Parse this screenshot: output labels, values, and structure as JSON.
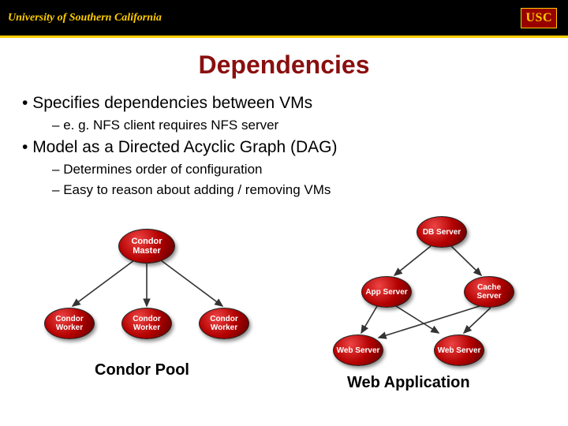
{
  "header": {
    "university": "University of Southern California",
    "logo_text": "USC"
  },
  "slide": {
    "title": "Dependencies",
    "bullets": [
      {
        "level": 1,
        "text": "Specifies dependencies between VMs"
      },
      {
        "level": 2,
        "text": "e. g. NFS client requires NFS server"
      },
      {
        "level": 1,
        "text": "Model as a Directed Acyclic Graph (DAG)"
      },
      {
        "level": 2,
        "text": "Determines order of configuration"
      },
      {
        "level": 2,
        "text": "Easy to reason about adding / removing VMs"
      }
    ]
  },
  "diagrams": {
    "left": {
      "label": "Condor Pool",
      "nodes": {
        "master": "Condor Master",
        "w1": "Condor Worker",
        "w2": "Condor Worker",
        "w3": "Condor Worker"
      }
    },
    "right": {
      "label": "Web Application",
      "nodes": {
        "db": "DB Server",
        "app": "App Server",
        "cache": "Cache Server",
        "web1": "Web Server",
        "web2": "Web Server"
      }
    }
  }
}
